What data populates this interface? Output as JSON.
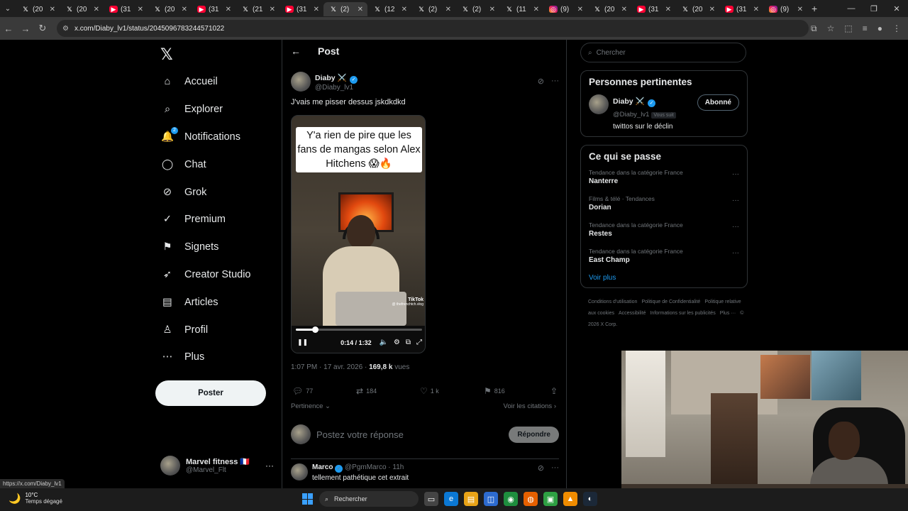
{
  "browser": {
    "tabs": [
      {
        "icon": "x",
        "title": "(20"
      },
      {
        "icon": "x",
        "title": "(20"
      },
      {
        "icon": "yt",
        "title": "(31"
      },
      {
        "icon": "x",
        "title": "(20"
      },
      {
        "icon": "yt",
        "title": "(31"
      },
      {
        "icon": "x",
        "title": "(21"
      },
      {
        "icon": "yt",
        "title": "(31"
      },
      {
        "icon": "x",
        "title": "(2)",
        "active": true
      },
      {
        "icon": "x",
        "title": "(12"
      },
      {
        "icon": "x",
        "title": "(2)"
      },
      {
        "icon": "x",
        "title": "(2)"
      },
      {
        "icon": "x",
        "title": "(11"
      },
      {
        "icon": "ig",
        "title": "(9)"
      },
      {
        "icon": "x",
        "title": "(20"
      },
      {
        "icon": "yt",
        "title": "(31"
      },
      {
        "icon": "x",
        "title": "(20"
      },
      {
        "icon": "yt",
        "title": "(31"
      },
      {
        "icon": "ig",
        "title": "(9)"
      }
    ],
    "new_tab": "+",
    "url": "x.com/Diaby_lv1/status/2045096783244571022",
    "status_url": "https://x.com/Diaby_lv1"
  },
  "sidebar": {
    "logo": "𝕏",
    "items": [
      {
        "label": "Accueil",
        "icon": "⌂"
      },
      {
        "label": "Explorer",
        "icon": "⌕"
      },
      {
        "label": "Notifications",
        "icon": "🔔",
        "badge": "2"
      },
      {
        "label": "Chat",
        "icon": "◯"
      },
      {
        "label": "Grok",
        "icon": "⊘"
      },
      {
        "label": "Premium",
        "icon": "✓"
      },
      {
        "label": "Signets",
        "icon": "⚑"
      },
      {
        "label": "Creator Studio",
        "icon": "➶"
      },
      {
        "label": "Articles",
        "icon": "▤"
      },
      {
        "label": "Profil",
        "icon": "♙"
      },
      {
        "label": "Plus",
        "icon": "⋯"
      }
    ],
    "post_button": "Poster",
    "account": {
      "name": "Marvel fitness 🇫🇷",
      "handle": "@Marvel_Flt"
    }
  },
  "main": {
    "back": "←",
    "title": "Post",
    "tweet": {
      "name": "Diaby ⚔️",
      "handle": "@Diaby_lv1",
      "text": "J'vais me pisser dessus jskdkdkd",
      "video": {
        "caption": "Y'a rien de pire que les fans de mangas selon Alex Hitchens 😱🔥",
        "watermark": "TikTok",
        "watermark_sub": "@ thefrenchtch.vlog",
        "time": "0:14 / 1:32",
        "progress": 0.152
      },
      "time": "1:07 PM · 17 avr. 2026 · ",
      "views_count": "169,8 k",
      "views_label": " vues",
      "stats": {
        "replies": "77",
        "reposts": "184",
        "likes": "1 k",
        "bookmarks": "816"
      },
      "sort_label": "Pertinence",
      "quotes_label": "Voir les citations"
    },
    "reply": {
      "placeholder": "Postez votre réponse",
      "button": "Répondre"
    },
    "first_reply": {
      "name": "Marco",
      "handle": "@PgmMarco · 11h",
      "text": "tellement pathétique cet extrait"
    }
  },
  "right": {
    "search_placeholder": "Chercher",
    "relevant": {
      "title": "Personnes pertinentes",
      "name": "Diaby ⚔️",
      "handle": "@Diaby_lv1",
      "follows_you": "Vous suit",
      "bio": "twittos sur le déclin",
      "button": "Abonné"
    },
    "trends": {
      "title": "Ce qui se passe",
      "items": [
        {
          "context": "Tendance dans la catégorie France",
          "name": "Nanterre"
        },
        {
          "context": "Films & télé · Tendances",
          "name": "Dorian"
        },
        {
          "context": "Tendance dans la catégorie France",
          "name": "Restes"
        },
        {
          "context": "Tendance dans la catégorie France",
          "name": "East Champ"
        }
      ],
      "see_more": "Voir plus"
    },
    "footer": [
      "Conditions d'utilisation",
      "Politique de Confidentialité",
      "Politique relative aux cookies",
      "Accessibilité",
      "Informations sur les publicités",
      "Plus ···",
      "© 2026 X Corp."
    ]
  },
  "taskbar": {
    "temperature": "10°C",
    "weather": "Temps dégagé",
    "search": "Rechercher"
  }
}
